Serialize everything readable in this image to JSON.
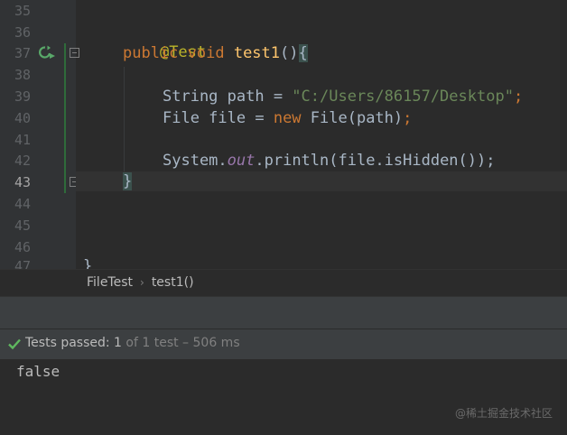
{
  "gutter": {
    "line_numbers": [
      "35",
      "36",
      "37",
      "38",
      "39",
      "40",
      "41",
      "42",
      "43",
      "44",
      "45",
      "46",
      "47"
    ],
    "current_line": "43"
  },
  "code": {
    "annotation": "@Test",
    "method_sig_kw": "public void ",
    "method_name": "test1",
    "method_parens": "()",
    "open_brace": "{",
    "line39_type": "String path = ",
    "line39_str": "\"C:/Users/86157/Desktop\"",
    "line39_semi": ";",
    "line40_a": "File file = ",
    "line40_new": "new ",
    "line40_b": "File(path)",
    "line40_semi": ";",
    "line42_a": "System.",
    "line42_out": "out",
    "line42_b": ".println(file.isHidden());",
    "close_brace": "}",
    "partial_brace": "}"
  },
  "breadcrumb": {
    "class_name": "FileTest",
    "separator": "›",
    "method_name": "test1()"
  },
  "run": {
    "status_label": "Tests passed: ",
    "passed_count": "1",
    "of_total": " of 1 test – 506 ms",
    "check_icon": "check-icon",
    "status_color": "#5fb85f"
  },
  "console": {
    "output": "false"
  },
  "watermark": {
    "text": "@稀土掘金技术社区"
  }
}
